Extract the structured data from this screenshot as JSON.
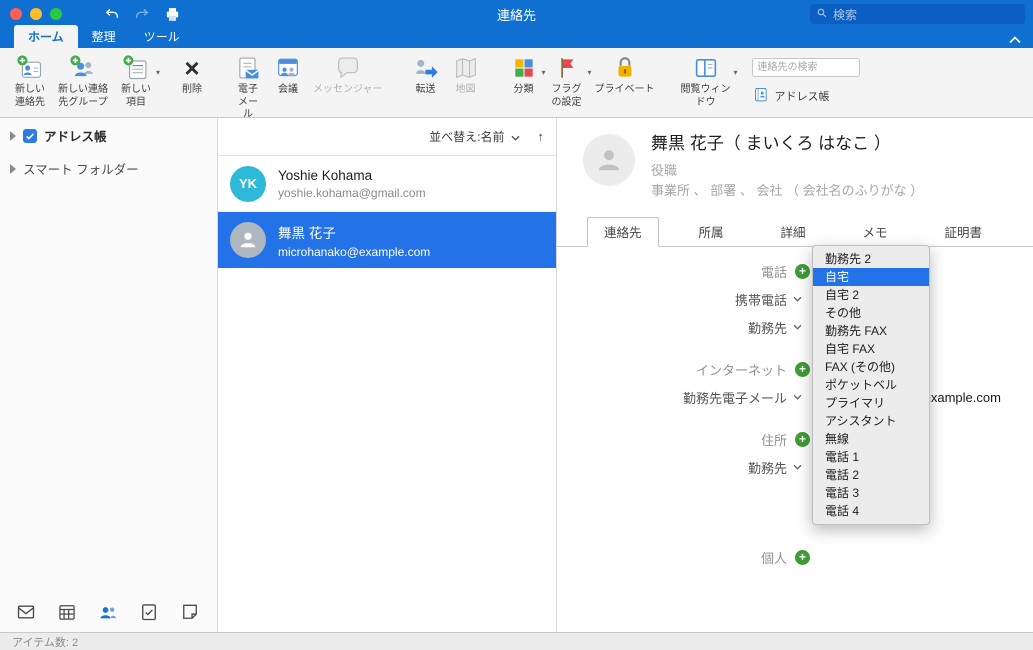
{
  "titlebar": {
    "title": "連絡先",
    "search_placeholder": "検索"
  },
  "tabs": [
    {
      "label": "ホーム"
    },
    {
      "label": "整理"
    },
    {
      "label": "ツール"
    }
  ],
  "ribbon": {
    "new_contact": "新しい連絡先",
    "new_contact_group": "新しい連絡先グループ",
    "new_item": "新しい項目",
    "delete": "削除",
    "email": "電子メール",
    "meeting": "会議",
    "messenger": "メッセンジャー",
    "forward": "転送",
    "map": "地図",
    "categorize": "分類",
    "flag": "フラグの設定",
    "private": "プライベート",
    "reading_pane": "閲覧ウィンドウ",
    "contact_search_placeholder": "連絡先の検索",
    "address_book": "アドレス帳"
  },
  "sidebar": {
    "address_book": "アドレス帳",
    "smart_folders": "スマート フォルダー"
  },
  "contact_list": {
    "sort_label": "並べ替え:名前",
    "contacts": [
      {
        "initials": "YK",
        "name": "Yoshie Kohama",
        "email": "yoshie.kohama@gmail.com"
      },
      {
        "initials": "",
        "name": "舞黒 花子",
        "email": "microhanako@example.com"
      }
    ]
  },
  "detail": {
    "name": "舞黒 花子（ まいくろ はなこ ）",
    "job_placeholder": "役職",
    "org_placeholder": "事業所 、 部署 、 会社 （ 会社名のふりがな ）",
    "tabs": [
      {
        "label": "連絡先"
      },
      {
        "label": "所属"
      },
      {
        "label": "詳細"
      },
      {
        "label": "メモ"
      },
      {
        "label": "証明書"
      }
    ],
    "fields": {
      "phone_section": "電話",
      "mobile_label": "携帯電話",
      "work_phone_label": "勤務先",
      "internet_section": "インターネット",
      "work_email_label": "勤務先電子メール",
      "work_email_value": "microhanako@example.com",
      "address_section": "住所",
      "work_address_label": "勤務先",
      "personal_section": "個人"
    },
    "label_menu": {
      "selected": "自宅",
      "items": [
        {
          "label": "勤務先 2"
        },
        {
          "label": "自宅"
        },
        {
          "label": "自宅 2"
        },
        {
          "label": "その他"
        },
        {
          "label": "勤務先 FAX"
        },
        {
          "label": "自宅 FAX"
        },
        {
          "label": "FAX (その他)"
        },
        {
          "label": "ポケットベル"
        },
        {
          "label": "プライマリ"
        },
        {
          "label": "アシスタント"
        },
        {
          "label": "無線"
        },
        {
          "label": "電話 1"
        },
        {
          "label": "電話 2"
        },
        {
          "label": "電話 3"
        },
        {
          "label": "電話 4"
        }
      ]
    }
  },
  "statusbar": {
    "item_count": "アイテム数: 2"
  },
  "colors": {
    "titlebar_blue": "#1070d2",
    "selection_blue": "#2472e8",
    "avatar_cyan": "#2fb9d8",
    "add_green": "#3f9c35"
  }
}
